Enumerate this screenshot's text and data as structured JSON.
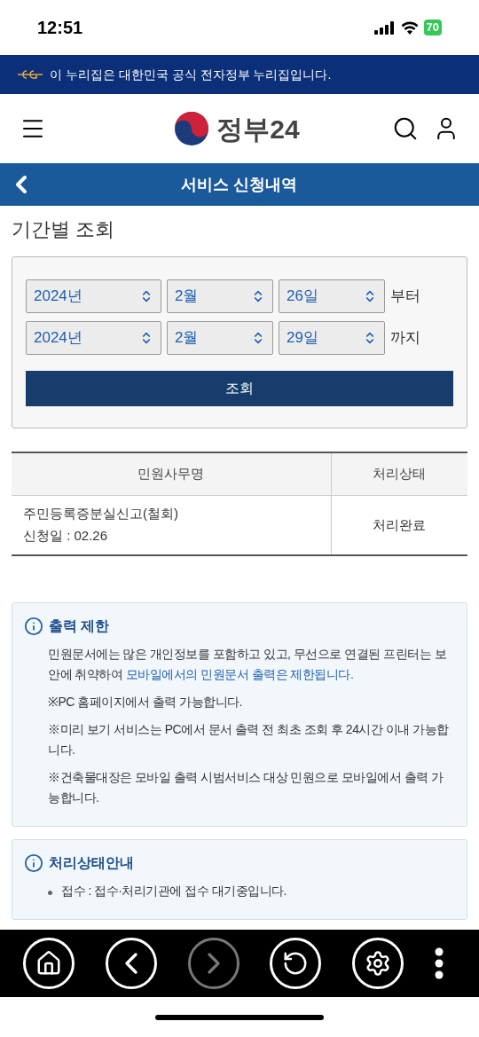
{
  "status_bar": {
    "time": "12:51",
    "battery": "70"
  },
  "gov_banner": {
    "text": "이 누리집은 대한민국 공식 전자정부 누리집입니다."
  },
  "header": {
    "logo_text": "정부24"
  },
  "title_bar": {
    "title": "서비스 신청내역"
  },
  "period_search": {
    "heading": "기간별 조회",
    "rows": [
      {
        "year": "2024년",
        "month": "2월",
        "day": "26일",
        "suffix": "부터"
      },
      {
        "year": "2024년",
        "month": "2월",
        "day": "29일",
        "suffix": "까지"
      }
    ],
    "button": "조회"
  },
  "table": {
    "columns": [
      "민원사무명",
      "처리상태"
    ],
    "rows": [
      {
        "name": "주민등록증분실신고(철회)",
        "date": "신청일 : 02.26",
        "status": "처리완료"
      }
    ]
  },
  "notices": [
    {
      "title": "출력 제한",
      "items": [
        {
          "kind": "paragraph",
          "text": "민원문서에는 많은 개인정보를 포함하고 있고, 무선으로 연결된 프린터는 보안에 취약하여 ",
          "link": "모바일에서의 민원문서 출력은 제한됩니다."
        },
        {
          "kind": "note",
          "text": "※PC 홈페이지에서 출력 가능합니다."
        },
        {
          "kind": "note",
          "text": "※미리 보기 서비스는 PC에서 문서 출력 전 최초 조회 후 24시간 이내 가능합니다."
        },
        {
          "kind": "note",
          "text": "※건축물대장은 모바일 출력 시범서비스 대상 민원으로 모바일에서 출력 가능합니다."
        }
      ]
    },
    {
      "title": "처리상태안내",
      "items": [
        {
          "kind": "bullet",
          "text": "접수 : 접수·처리기관에 접수 대기중입니다."
        }
      ]
    }
  ],
  "toolbar": [
    {
      "kind": "home",
      "disabled": false
    },
    {
      "kind": "back",
      "disabled": false
    },
    {
      "kind": "forward",
      "disabled": true
    },
    {
      "kind": "reload",
      "disabled": false
    },
    {
      "kind": "settings",
      "disabled": false
    },
    {
      "kind": "more",
      "disabled": false
    }
  ]
}
